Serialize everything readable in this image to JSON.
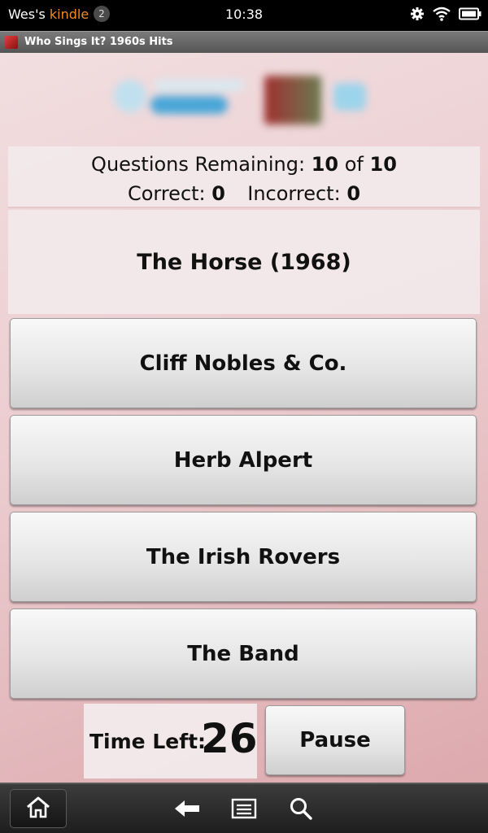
{
  "status_bar": {
    "owner_prefix": "Wes's ",
    "owner_brand": "kindle",
    "notification_count": "2",
    "time": "10:38"
  },
  "title_bar": {
    "title": "Who Sings It? 1960s Hits"
  },
  "score": {
    "remaining_label": "Questions Remaining:",
    "remaining_value": "10",
    "of_label": "of",
    "total_value": "10",
    "correct_label": "Correct:",
    "correct_value": "0",
    "incorrect_label": "Incorrect:",
    "incorrect_value": "0"
  },
  "question": {
    "text": "The Horse (1968)"
  },
  "answers": [
    {
      "label": "Cliff Nobles & Co."
    },
    {
      "label": "Herb Alpert"
    },
    {
      "label": "The Irish Rovers"
    },
    {
      "label": "The Band"
    }
  ],
  "timer": {
    "label": "Time Left:",
    "value": "26"
  },
  "controls": {
    "pause_label": "Pause"
  },
  "colors": {
    "kindle_accent": "#f08a24",
    "background_top": "#f2e0e2",
    "background_bottom": "#dba6aa"
  },
  "icons": {
    "status": [
      "settings-gear-icon",
      "wifi-icon",
      "battery-icon"
    ],
    "nav": [
      "home-icon",
      "back-arrow-icon",
      "menu-icon",
      "search-icon"
    ]
  }
}
